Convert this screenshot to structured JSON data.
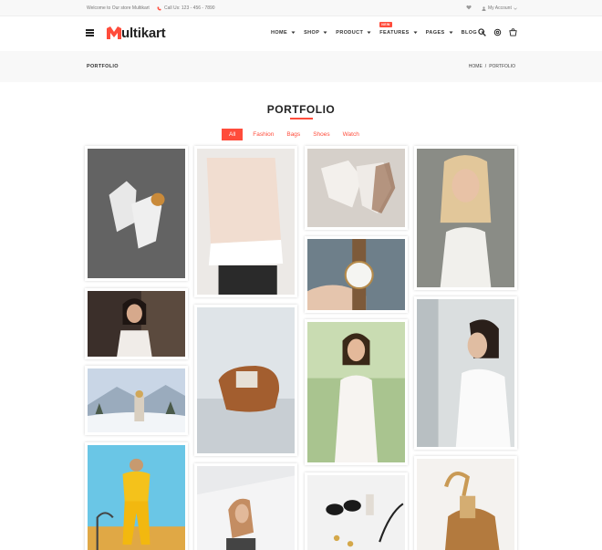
{
  "topbar": {
    "welcome": "Welcome to Our store Multikart",
    "call": "Call Us: 123 - 456 - 7890",
    "account": "My Account"
  },
  "header": {
    "logo": "ultikart",
    "nav": [
      {
        "label": "HOME",
        "badge": ""
      },
      {
        "label": "SHOP",
        "badge": ""
      },
      {
        "label": "PRODUCT",
        "badge": ""
      },
      {
        "label": "FEATURES",
        "badge": "NEW"
      },
      {
        "label": "PAGES",
        "badge": ""
      },
      {
        "label": "BLOG",
        "badge": ""
      }
    ]
  },
  "breadcrumb": {
    "page": "PORTFOLIO",
    "home": "HOME",
    "sep": "/",
    "current": "PORTFOLIO"
  },
  "page": {
    "title": "PORTFOLIO"
  },
  "filters": [
    "All",
    "Fashion",
    "Bags",
    "Shoes",
    "Watch"
  ],
  "colors": {
    "accent": "#ff4c3b"
  },
  "icons": [
    "menu-icon",
    "search-icon",
    "settings-icon",
    "cart-icon",
    "heart-icon",
    "user-icon",
    "phone-icon"
  ]
}
